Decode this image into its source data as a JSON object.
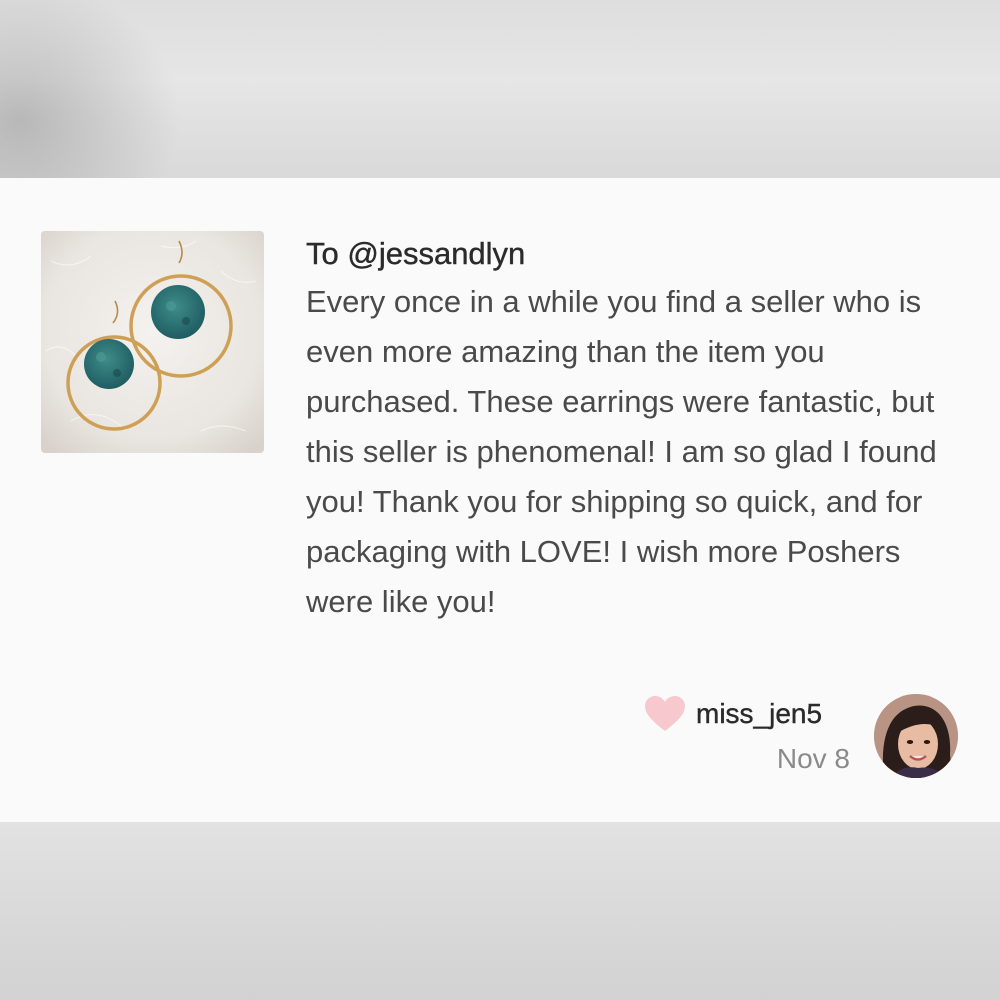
{
  "review": {
    "recipient": "To @jessandlyn",
    "body": "Every once in a while you find a seller who is even more amazing than the item you purchased. These earrings were fantastic, but this seller is phenomenal! I am so glad I found you! Thank you for shipping so quick, and for packaging with LOVE! I wish more Poshers were like you!",
    "username": "miss_jen5",
    "date": "Nov 8"
  },
  "product_image": {
    "icon": "earrings-photo"
  },
  "colors": {
    "heart": "#f7c9cf",
    "card_background": "#fafafa",
    "text_primary": "#2b2b2b",
    "text_secondary": "#4a4a4a",
    "text_muted": "#8a8a8a"
  }
}
